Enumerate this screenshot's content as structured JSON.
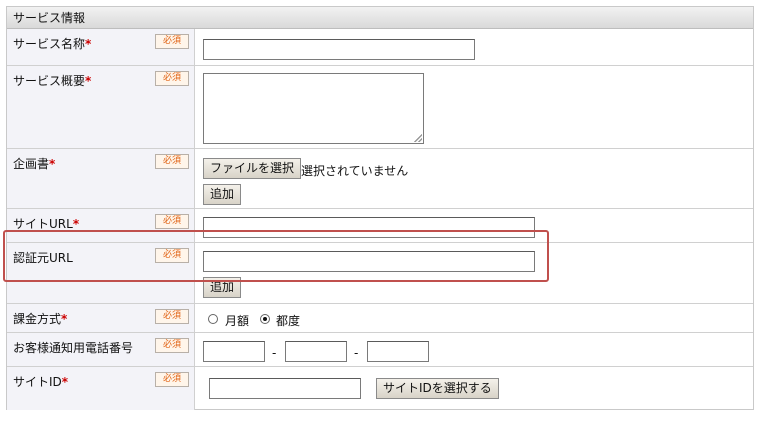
{
  "section": {
    "title": "サービス情報"
  },
  "required_badge": "必須",
  "required_marker": "*",
  "rows": {
    "service_name": {
      "label": "サービス名称",
      "required": true
    },
    "service_summary": {
      "label": "サービス概要",
      "required": true
    },
    "proposal": {
      "label": "企画書",
      "required": true,
      "file_button": "ファイルを選択",
      "file_status": "選択されていません",
      "add_button": "追加"
    },
    "site_url": {
      "label": "サイトURL",
      "required": true
    },
    "auth_url": {
      "label": "認証元URL",
      "required": false,
      "add_button": "追加"
    },
    "billing": {
      "label": "課金方式",
      "required": true,
      "options": [
        "月額",
        "都度"
      ],
      "selected": "都度"
    },
    "phone": {
      "label": "お客様通知用電話番号",
      "required": false,
      "separator": "-"
    },
    "site_id": {
      "label": "サイトID",
      "required": true,
      "select_button": "サイトIDを選択する"
    }
  },
  "highlight_color": "#c0504d"
}
